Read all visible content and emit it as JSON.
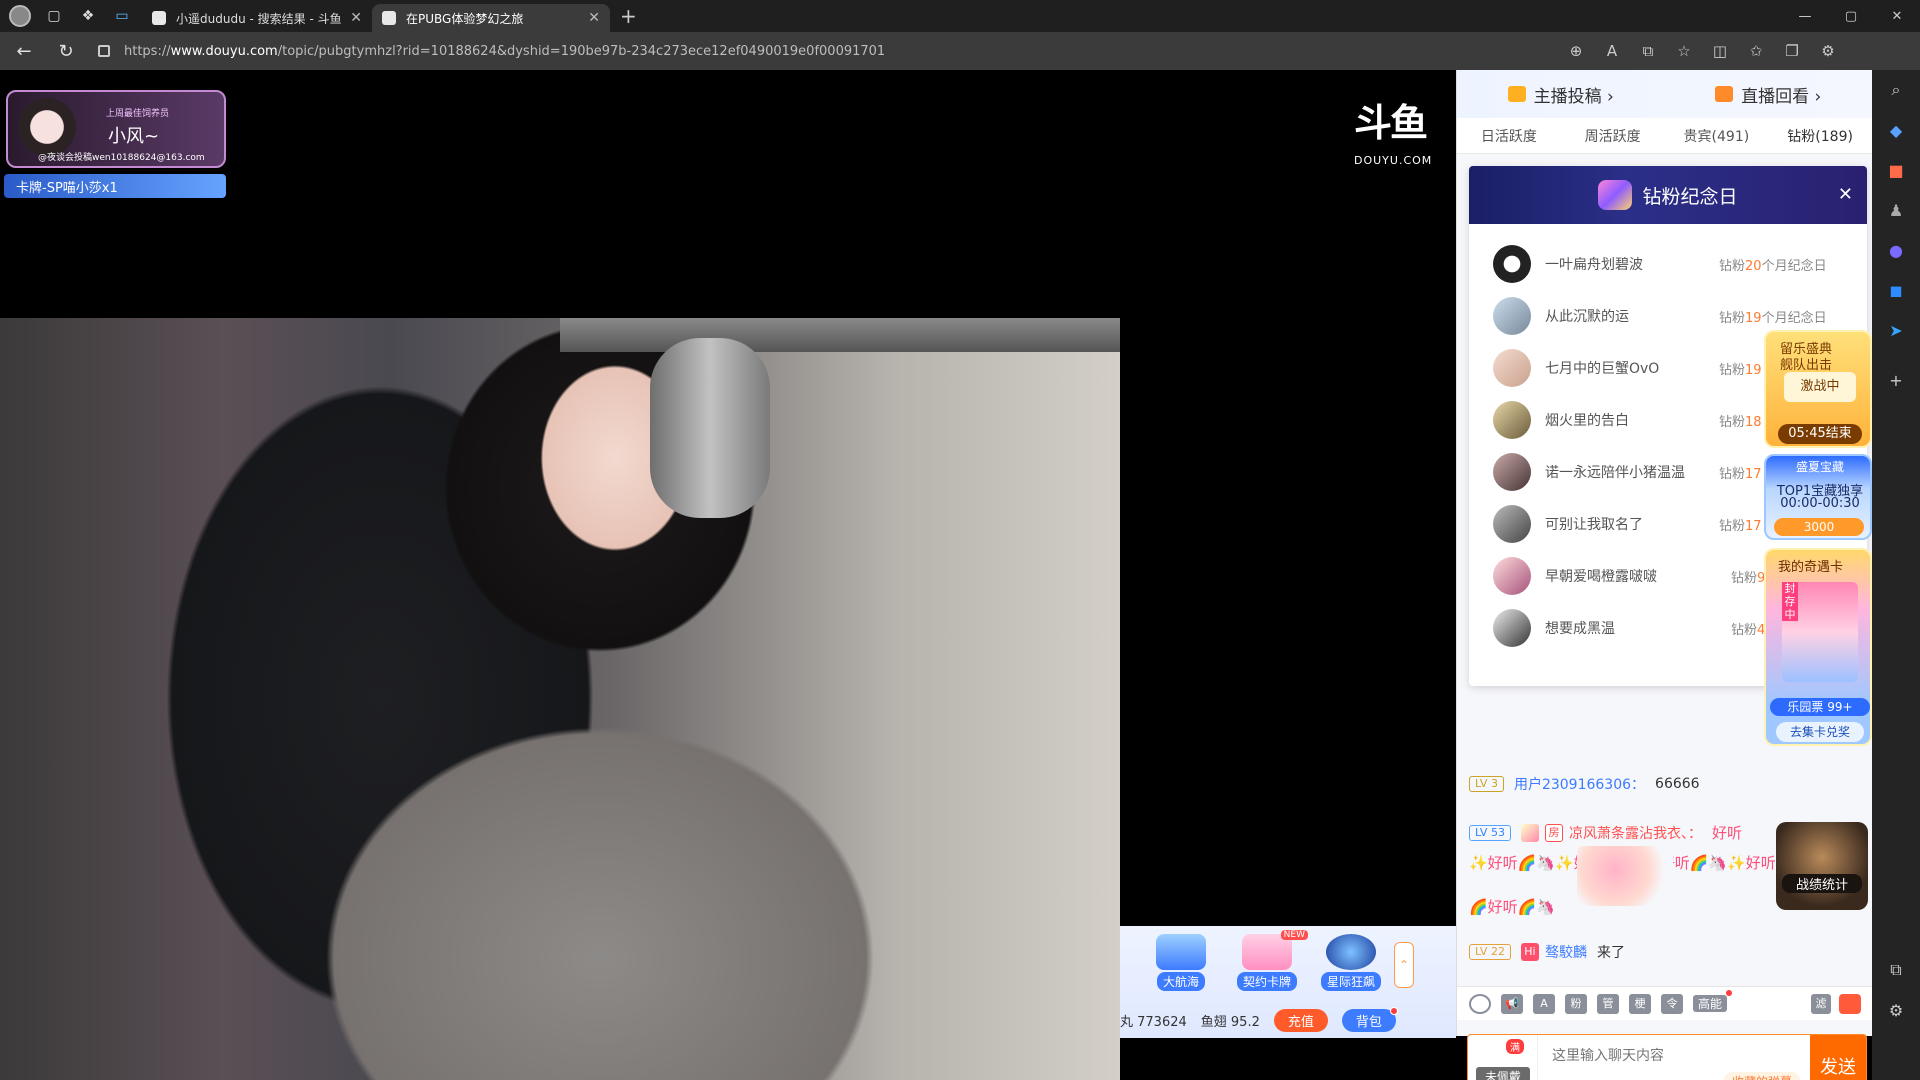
{
  "browser": {
    "tabs": [
      {
        "title": "小遥dududu - 搜索结果 - 斗鱼直",
        "active": false
      },
      {
        "title": "在PUBG体验梦幻之旅",
        "active": true
      }
    ],
    "url_prefix": "https://",
    "url_domain": "www.douyu.com",
    "url_path": "/topic/pubgtymhzl?rid=10188624&dyshid=190be97b-234c273ece12ef0490019e0f00091701"
  },
  "overlay": {
    "streamer_small": "上周最佳饲养员",
    "streamer_name": "小风~",
    "streamer_email": "@夜谈会投稿wen10188624@163.com",
    "card_strip": "卡牌-SP喵小莎x1",
    "logo_text": "斗鱼",
    "logo_sub": "DOUYU.COM"
  },
  "giftbar": {
    "gifts": [
      {
        "label": "大航海",
        "new": false
      },
      {
        "label": "契约卡牌",
        "new": true
      },
      {
        "label": "星际狂飙",
        "new": false
      }
    ],
    "new_badge": "NEW",
    "yuwan": "丸 773624",
    "yuchi": "鱼翅 95.2",
    "recharge": "充值",
    "backpack": "背包"
  },
  "right_panel": {
    "header": {
      "upload": "主播投稿 ›",
      "replay": "直播回看 ›"
    },
    "tabs": [
      "日活跃度",
      "周活跃度",
      "贵宾(491)",
      "钻粉(189)"
    ],
    "anniversary": {
      "title": "钻粉纪念日",
      "rows": [
        {
          "name": "一叶扁舟划碧波",
          "prefix": "钻粉",
          "num": "20",
          "suffix": "个月纪念日"
        },
        {
          "name": "从此沉默的运",
          "prefix": "钻粉",
          "num": "19",
          "suffix": "个月纪念日"
        },
        {
          "name": "七月中的巨蟹OvO",
          "prefix": "钻粉",
          "num": "19",
          "suffix": ""
        },
        {
          "name": "烟火里的告白",
          "prefix": "钻粉",
          "num": "18",
          "suffix": ""
        },
        {
          "name": "诺一永远陪伴小猪温温",
          "prefix": "钻粉",
          "num": "17",
          "suffix": ""
        },
        {
          "name": "可别让我取名了",
          "prefix": "钻粉",
          "num": "17",
          "suffix": ""
        },
        {
          "name": "早朝爱喝橙露啵啵",
          "prefix": "钻粉",
          "num": "9",
          "suffix": ""
        },
        {
          "name": "想要成黑温",
          "prefix": "钻粉",
          "num": "4",
          "suffix": ""
        }
      ]
    },
    "activities": {
      "a_title": "留乐盛典",
      "a_sub": "舰队出击",
      "a_mid": "激战中",
      "a_time": "05:45结束",
      "b_title": "盛夏宝藏",
      "b_top": "TOP1宝藏独享",
      "b_time": "00:00-00:30",
      "b_num": "3000",
      "c_title": "我的奇遇卡",
      "c_tag": "封存中",
      "c_ticket": "乐园票 99+",
      "c_btn": "去集卡兑奖",
      "d_label": "战绩统计"
    },
    "chat": [
      {
        "level": "LV 3",
        "user": "用户2309166306：",
        "text": "66666"
      },
      {
        "level": "LV 53",
        "medal": "房",
        "user": "凉风萧条露沾我衣、：",
        "text": "好听"
      },
      {
        "text": "✨好听🌈🦄✨好听🌈🦄✨好听🌈🦄✨好听"
      },
      {
        "text": "🌈好听🌈🦄"
      },
      {
        "level": "LV 22",
        "medal": "Hi",
        "user": "骜駮麟",
        "text": "来了"
      }
    ],
    "chat_tools": {
      "hi_label": "高能",
      "filter": "滤"
    },
    "input": {
      "badge_full": "满",
      "badge_label": "未佩戴",
      "placeholder": "这里输入聊天内容",
      "saved": "收藏的弹幕",
      "send": "发送"
    }
  }
}
